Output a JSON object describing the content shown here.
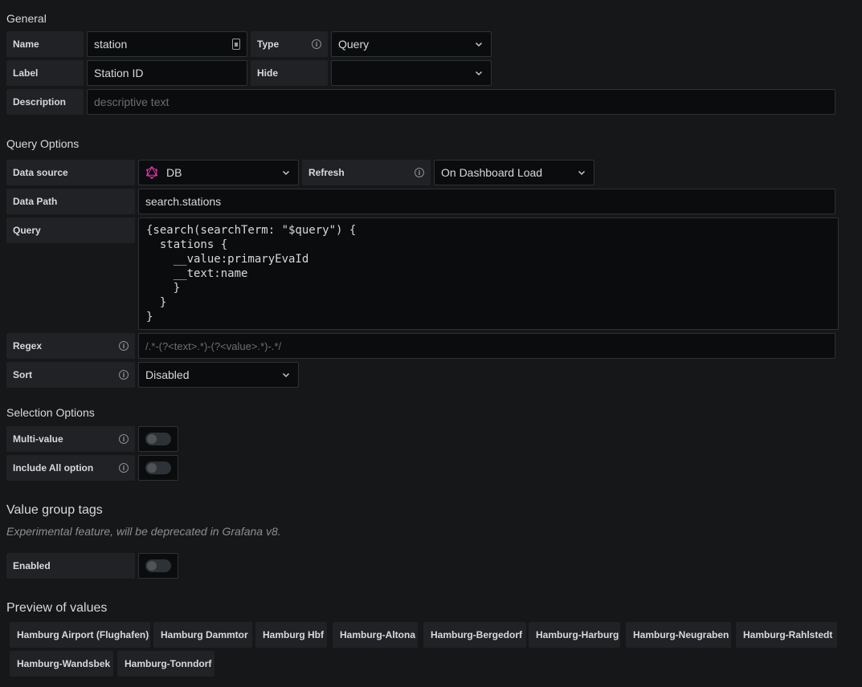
{
  "general": {
    "title": "General",
    "name_label": "Name",
    "name_value": "station",
    "type_label": "Type",
    "type_value": "Query",
    "label_label": "Label",
    "label_value": "Station ID",
    "hide_label": "Hide",
    "hide_value": "",
    "description_label": "Description",
    "description_placeholder": "descriptive text"
  },
  "query_options": {
    "title": "Query Options",
    "datasource_label": "Data source",
    "datasource_value": "DB",
    "refresh_label": "Refresh",
    "refresh_value": "On Dashboard Load",
    "datapath_label": "Data Path",
    "datapath_value": "search.stations",
    "query_label": "Query",
    "query_value": "{search(searchTerm: \"$query\") {\n  stations {\n    __value:primaryEvaId\n    __text:name\n    }\n  }\n}",
    "regex_label": "Regex",
    "regex_placeholder": "/.*-(?<text>.*)-(?<value>.*)-.*/",
    "sort_label": "Sort",
    "sort_value": "Disabled"
  },
  "selection_options": {
    "title": "Selection Options",
    "multi_label": "Multi-value",
    "multi_enabled": false,
    "include_all_label": "Include All option",
    "include_all_enabled": false
  },
  "value_group_tags": {
    "title": "Value group tags",
    "hint": "Experimental feature, will be deprecated in Grafana v8.",
    "enabled_label": "Enabled",
    "enabled": false
  },
  "preview": {
    "title": "Preview of values",
    "values": [
      "Hamburg Airport (Flughafen)",
      "Hamburg Dammtor",
      "Hamburg Hbf",
      "Hamburg-Altona",
      "Hamburg-Bergedorf",
      "Hamburg-Harburg",
      "Hamburg-Neugraben",
      "Hamburg-Rahlstedt",
      "Hamburg-Wandsbek",
      "Hamburg-Tonndorf"
    ]
  },
  "colors": {
    "background": "#161719",
    "label_bg": "#202226",
    "input_bg": "#0b0c0e",
    "border": "#2c3235",
    "datasource_icon": "#e535ab"
  }
}
